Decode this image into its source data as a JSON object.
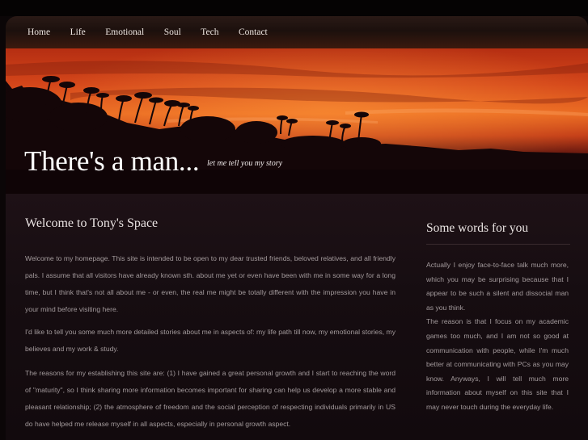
{
  "nav": {
    "items": [
      {
        "label": "Home"
      },
      {
        "label": "Life"
      },
      {
        "label": "Emotional"
      },
      {
        "label": "Soul"
      },
      {
        "label": "Tech"
      },
      {
        "label": "Contact"
      }
    ]
  },
  "hero": {
    "title": "There's a man...",
    "subtitle": "let me tell you my story"
  },
  "main": {
    "heading": "Welcome to Tony's Space",
    "paragraphs": [
      "Welcome to my homepage. This site is intended to be open to my dear trusted friends, beloved relatives, and all friendly pals. I assume that all visitors have already known sth. about me yet or even have been with me in some way for a long time, but I think that's not all about me - or even, the real me might be totally different with the impression you have in your mind before visiting here.",
      "I'd like to tell you some much more detailed stories about me in aspects of: my life path till now, my emotional stories, my believes and my work & study.",
      "The reasons for my establishing this site are: (1) I have gained a great personal growth and I start to reaching the word of \"maturity\", so I think sharing more information becomes important for sharing can help us develop a more stable and pleasant relationship; (2) the atmosphere of freedom and the social perception of respecting individuals primarily in US do have helped me release myself in all aspects, especially in personal growth aspect."
    ]
  },
  "sidebar": {
    "heading": "Some words for you",
    "text_1": "Actually I enjoy face-to-face talk much more, which you may be surprising because that I appear to be such a silent and dissocial man as you think.",
    "text_2": "The reason is that I focus on my academic games too much, and I am not so good at communication with people, while I'm much better at communicating with PCs as you may know. Anyways, I will tell much more information about myself on this site that I may never touch during the everyday life."
  },
  "colors": {
    "accent_sky": "#d4461a",
    "background": "#0b0607",
    "text": "#a39a9c"
  }
}
